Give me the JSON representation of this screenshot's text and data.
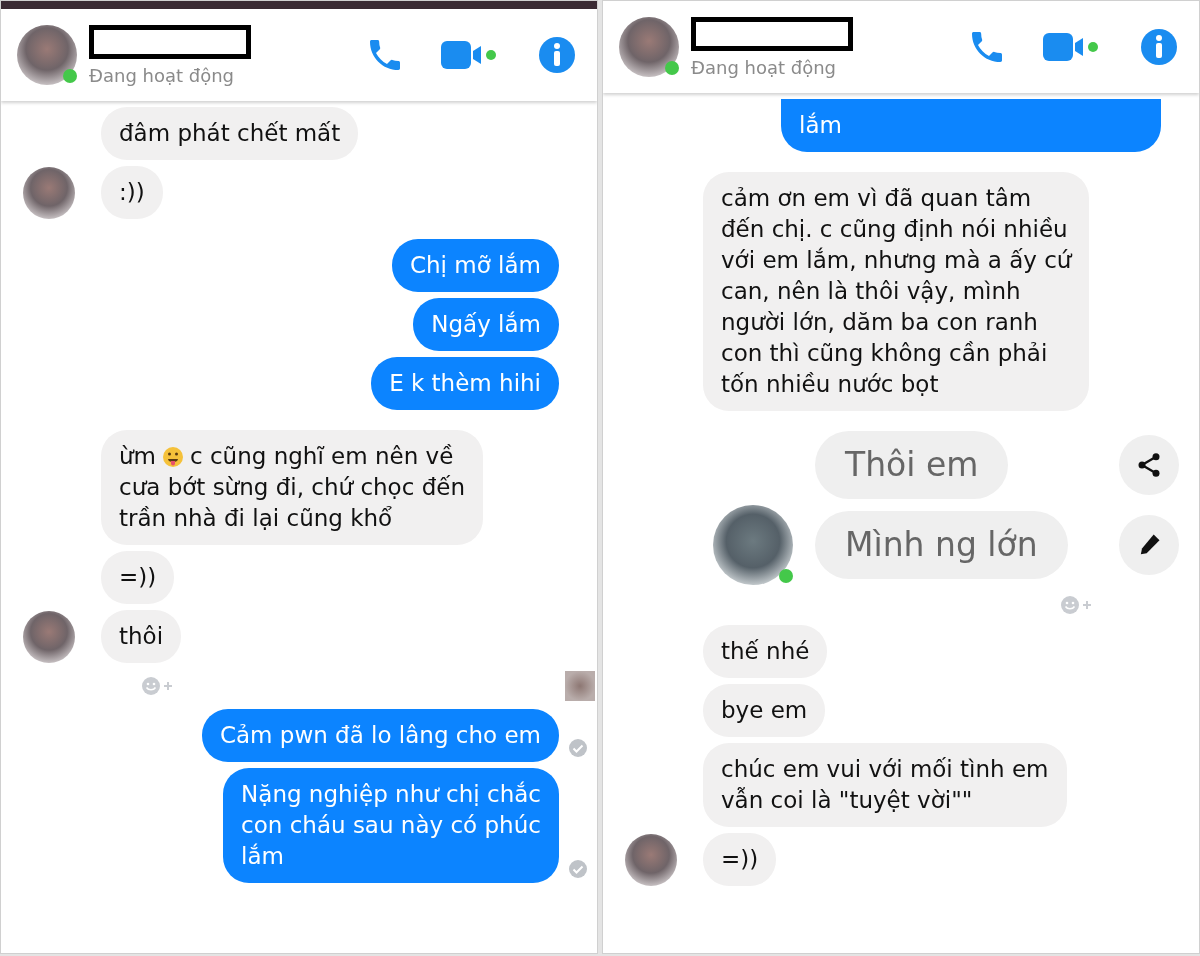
{
  "panels": [
    {
      "header": {
        "status": "Đang hoạt động",
        "online": true
      },
      "backdrop": true,
      "messages": [
        {
          "kind": "incoming",
          "text": "đâm phát chết mất"
        },
        {
          "kind": "incoming",
          "text": ":))",
          "avatar": true
        },
        {
          "kind": "outgoing",
          "text": "Chị mỡ lắm"
        },
        {
          "kind": "outgoing",
          "text": "Ngấy lắm"
        },
        {
          "kind": "outgoing",
          "text": "E k thèm hihi"
        },
        {
          "kind": "incoming",
          "parts": [
            {
              "kind": "text",
              "text": "ừm"
            },
            {
              "kind": "emoji"
            },
            {
              "kind": "text",
              "text": "c cũng nghĩ em nên về"
            },
            {
              "kind": "paragraph",
              "text": "cưa bớt sừng đi, chứ chọc đến\ntrần nhà đi lại cũng khổ"
            }
          ]
        },
        {
          "kind": "incoming",
          "text": "=))"
        },
        {
          "kind": "incoming",
          "text": "thôi",
          "avatar": true
        },
        {
          "kind": "reaction",
          "seen_avatar": true
        },
        {
          "kind": "outgoing",
          "text": "Cảm pwn đã lo lâng cho em",
          "seen": true
        },
        {
          "kind": "outgoing",
          "text": "Nặng nghiệp như chị chắc\ncon cháu sau này có phúc\nlắm",
          "seen": true
        }
      ]
    },
    {
      "header": {
        "status": "Đang hoạt động",
        "online": true
      },
      "backdrop": false,
      "messages": [
        {
          "kind": "outgoing",
          "text": "lắm",
          "cut": true
        },
        {
          "kind": "incoming",
          "text": "cảm ơn em vì đã quan tâm\nđến chị. c cũng định nói nhiều\nvới em lắm, nhưng mà a ấy cứ\ncan, nên là thôi vậy, mình\nngười lớn, dăm ba con ranh\ncon thì cũng không cần phải\ntốn nhiều nước bọt"
        },
        {
          "kind": "large",
          "text": "Thôi em",
          "action": {
            "kind": "share"
          }
        },
        {
          "kind": "large",
          "text": "Mình ng lớn",
          "action": {
            "kind": "edit"
          },
          "avatar": true,
          "online": true
        },
        {
          "kind": "reaction",
          "seen_avatar": false
        },
        {
          "kind": "incoming",
          "text": "thế nhé"
        },
        {
          "kind": "incoming",
          "text": "bye em"
        },
        {
          "kind": "incoming",
          "text": "chúc em vui với mối tình em\nvẫn coi là \"tuyệt vời\"\""
        },
        {
          "kind": "incoming",
          "text": "=))",
          "avatar": true
        }
      ]
    }
  ]
}
